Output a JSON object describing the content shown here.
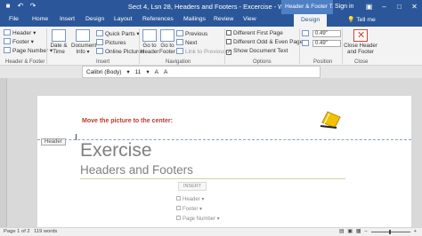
{
  "window": {
    "title": "Sect 4, Lsn 28, Headers and Footers - Excercise - Word",
    "context_tab_title": "Header & Footer T...",
    "sign_in": "Sign in",
    "tell_me": "Tell me"
  },
  "tabs": [
    "File",
    "Home",
    "Insert",
    "Design",
    "Layout",
    "References",
    "Mailings",
    "Review",
    "View",
    "Design"
  ],
  "ribbon": {
    "header_footer_group": {
      "header": "Header ▾",
      "footer": "Footer ▾",
      "page_number": "Page Number ▾",
      "label": "Header & Footer"
    },
    "insert_group": {
      "date_time": "Date & Time",
      "document_info": "Document Info ▾",
      "quick_parts": "Quick Parts ▾",
      "pictures": "Pictures",
      "online_pictures": "Online Pictures",
      "label": "Insert"
    },
    "navigation_group": {
      "goto_header": "Go to Header",
      "goto_footer": "Go to Footer",
      "previous": "Previous",
      "next": "Next",
      "link_to_previous": "Link to Previous",
      "label": "Navigation"
    },
    "options_group": {
      "different_first_page": "Different First Page",
      "different_odd_even": "Different Odd & Even Pages",
      "show_document_text": "Show Document Text",
      "label": "Options"
    },
    "position_group": {
      "header_from_top": "0.49\"",
      "footer_from_bottom": "0.49\"",
      "label": "Position"
    },
    "close_group": {
      "close_button": "Close Header and Footer",
      "label": "Close"
    }
  },
  "format_bar": {
    "font": "Calibri (Body)",
    "size": "11"
  },
  "document": {
    "instruction": "Move the picture to the center:",
    "header_tag": "Header",
    "title": "Exercise",
    "subtitle": "Headers and Footers"
  },
  "insert_popup": {
    "title": "INSERT",
    "items": [
      "Header ▾",
      "Footer ▾",
      "Page Number ▾"
    ]
  },
  "status": {
    "page": "Page 1 of 2",
    "words": "119 words"
  },
  "colors": {
    "accent": "#2b579a",
    "instruction_red": "#c0392b"
  }
}
